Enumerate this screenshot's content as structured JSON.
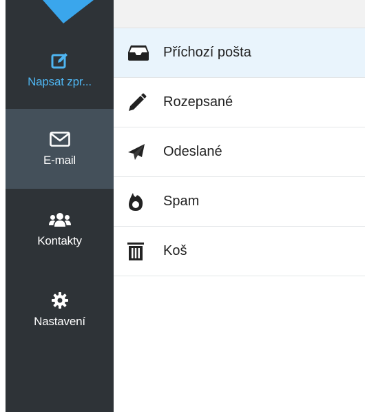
{
  "sidebar": {
    "items": [
      {
        "label": "Napsat zpr...",
        "icon": "pen-to-square-icon"
      },
      {
        "label": "E-mail",
        "icon": "envelope-icon"
      },
      {
        "label": "Kontakty",
        "icon": "users-icon"
      },
      {
        "label": "Nastavení",
        "icon": "gear-icon"
      }
    ]
  },
  "folders": [
    {
      "label": "Příchozí pošta",
      "icon": "inbox-icon"
    },
    {
      "label": "Rozepsané",
      "icon": "pencil-icon"
    },
    {
      "label": "Odeslané",
      "icon": "paper-plane-icon"
    },
    {
      "label": "Spam",
      "icon": "fire-icon"
    },
    {
      "label": "Koš",
      "icon": "trash-icon"
    }
  ],
  "colors": {
    "sidebar_bg": "#2e3337",
    "sidebar_active_bg": "#44505a",
    "accent": "#4fb6f2",
    "active_folder_bg": "#e9f4fc"
  }
}
